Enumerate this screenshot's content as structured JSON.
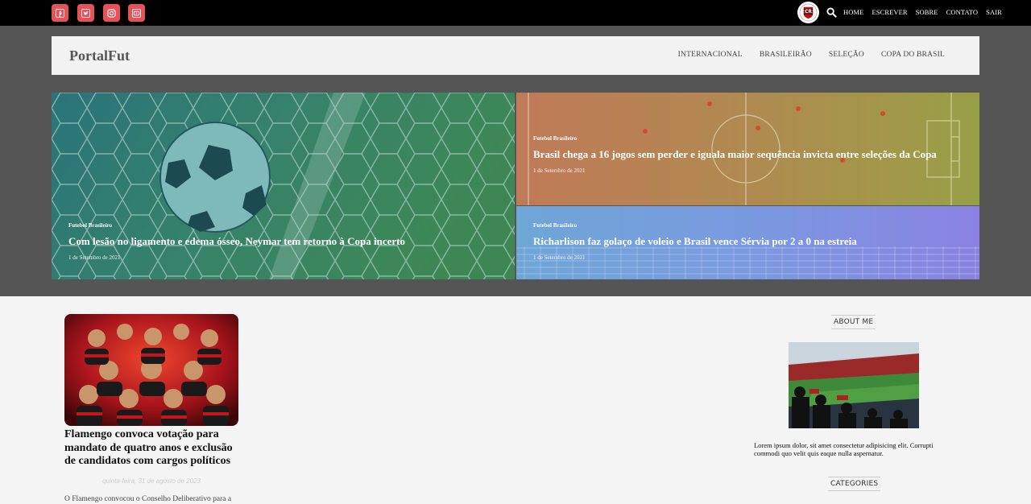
{
  "topbar": {
    "social": [
      {
        "icon": "facebook-icon"
      },
      {
        "icon": "twitter-icon"
      },
      {
        "icon": "instagram-icon"
      },
      {
        "icon": "youtube-icon"
      }
    ],
    "nav": [
      "HOME",
      "ESCREVER",
      "SOBRE",
      "CONTATO",
      "SAIR"
    ]
  },
  "header": {
    "logo": "PortalFut",
    "nav": [
      "INTERNACIONAL",
      "BRASILEIRÃO",
      "SELEÇÃO",
      "COPA DO BRASIL"
    ]
  },
  "featured": [
    {
      "category": "Futebol Brasileiro",
      "title": "Com lesão no ligamento e edema ósseo, Neymar tem retorno à Copa incerto",
      "date": "1 de Setembro de 2021"
    },
    {
      "category": "Futebol Brasileiro",
      "title": "Brasil chega a 16 jogos sem perder e iguala maior sequência invicta entre seleções da Copa",
      "date": "1 de Setembro de 2021"
    },
    {
      "category": "Futebol Brasileiro",
      "title": "Richarlison faz golaço de voleio e Brasil vence Sérvia por 2 a 0 na estreia",
      "date": "1 de Setembro de 2021"
    }
  ],
  "post": {
    "title": "Flamengo convoca votação para mandato de quatro anos e exclusão de candidatos com cargos políticos",
    "date": "quinta-feira, 31 de agosto de 2023",
    "excerpt": "O Flamengo convocou o Conselho Deliberativo para a"
  },
  "sidebar": {
    "about_heading": "ABOUT ME",
    "about_text": "Lorem ipsum dolor, sit amet consectetur adipisicing elit. Corrupti commodi quo velit quis eaque nulla aspernatur.",
    "categories_heading": "CATEGORIES"
  },
  "colors": {
    "topbar": "#000000",
    "social": "#e5535a",
    "band": "#555555",
    "header": "#f2f2f2",
    "page": "#f4f4f4"
  }
}
